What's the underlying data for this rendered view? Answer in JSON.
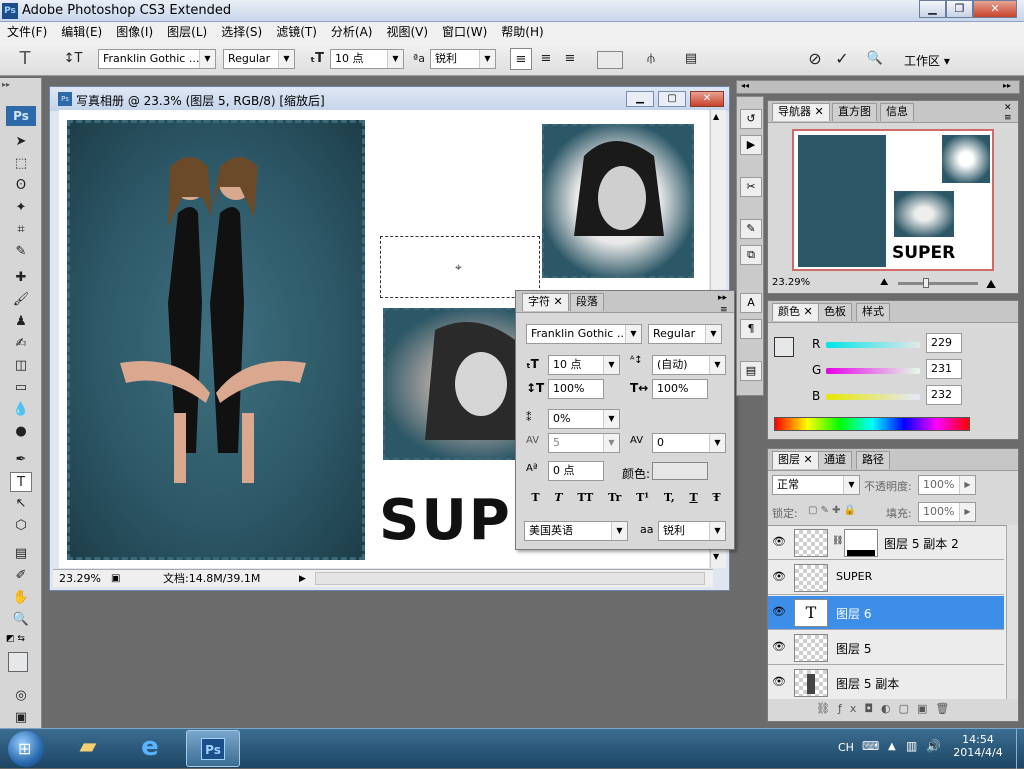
{
  "app": {
    "title": "Adobe Photoshop CS3 Extended",
    "logo": "Ps"
  },
  "menu": [
    "文件(F)",
    "编辑(E)",
    "图像(I)",
    "图层(L)",
    "选择(S)",
    "滤镜(T)",
    "分析(A)",
    "视图(V)",
    "窗口(W)",
    "帮助(H)"
  ],
  "options": {
    "font_family": "Franklin Gothic ...",
    "font_style": "Regular",
    "font_size": "10 点",
    "antialias": "锐利",
    "workspace": "工作区"
  },
  "document": {
    "title": "写真相册 @ 23.3% (图层 5, RGB/8) [缩放后]",
    "zoom": "23.29%",
    "doc_size": "文档:14.8M/39.1M",
    "canvas_text": "SUP"
  },
  "char_panel": {
    "tabs": [
      "字符",
      "段落"
    ],
    "font_family": "Franklin Gothic ...",
    "font_style": "Regular",
    "size": "10 点",
    "leading": "(自动)",
    "vscale": "100%",
    "hscale": "100%",
    "tracking_pct": "0%",
    "kerning": "5",
    "tracking": "0",
    "baseline": "0 点",
    "color_label": "颜色:",
    "style_buttons": [
      "T",
      "T",
      "TT",
      "Tr",
      "T¹",
      "T,",
      "T",
      "Ŧ"
    ],
    "language": "美国英语",
    "antialias_icon": "aa",
    "antialias": "锐利"
  },
  "navigator": {
    "tabs": [
      "导航器",
      "直方图",
      "信息"
    ],
    "zoom": "23.29%",
    "preview_text": "SUPER"
  },
  "color": {
    "tabs": [
      "颜色",
      "色板",
      "样式"
    ],
    "r_label": "R",
    "r": "229",
    "g_label": "G",
    "g": "231",
    "b_label": "B",
    "b": "232"
  },
  "layers": {
    "tabs": [
      "图层",
      "通道",
      "路径"
    ],
    "blend_mode": "正常",
    "opacity_label": "不透明度:",
    "opacity": "100%",
    "lock_label": "锁定:",
    "fill_label": "填充:",
    "fill": "100%",
    "items": [
      {
        "name": "图层 5 副本 2",
        "selected": false
      },
      {
        "name": "SUPER",
        "selected": false
      },
      {
        "name": "图层 6",
        "selected": true,
        "thumb": "T"
      },
      {
        "name": "图层 5",
        "selected": false
      },
      {
        "name": "图层 5 副本",
        "selected": false
      }
    ]
  },
  "taskbar": {
    "lang": "CH",
    "time": "14:54",
    "date": "2014/4/4",
    "ps_label": "Ps"
  },
  "colors": {
    "accent": "#3d8ee8",
    "teal": "#2c5766",
    "title": "#c5d4ea"
  }
}
